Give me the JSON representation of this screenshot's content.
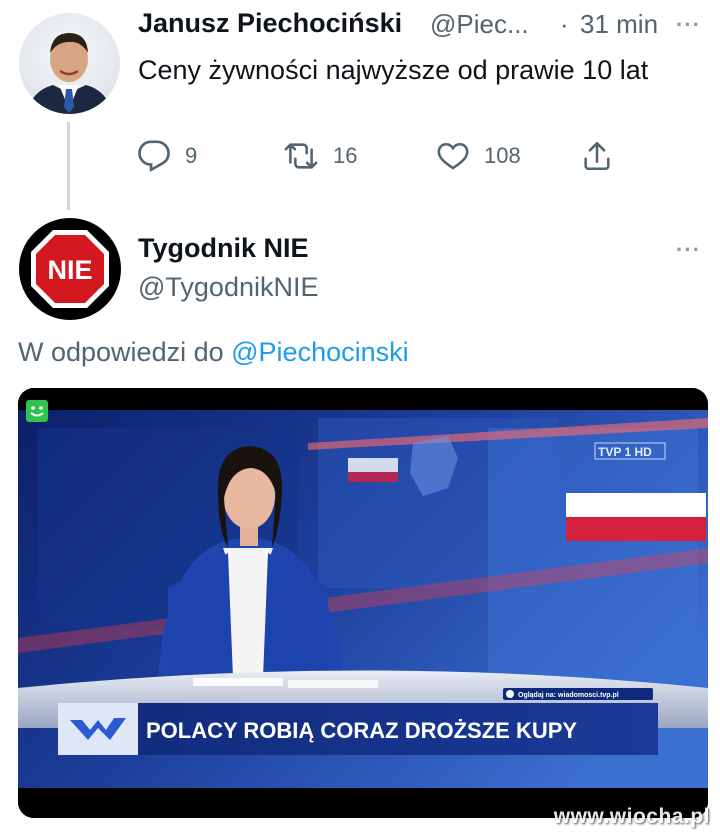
{
  "tweet1": {
    "name": "Janusz Piechociński",
    "handle": "@Piec...",
    "separator": "·",
    "time": "31 min",
    "more": "···",
    "text": "Ceny żywności najwyższe od prawie 10 lat",
    "replies": "9",
    "retweets": "16",
    "likes": "108"
  },
  "tweet2": {
    "name": "Tygodnik NIE",
    "handle": "@TygodnikNIE",
    "more": "···",
    "avatar_text": "NIE",
    "reply_prefix": "W odpowiedzi do",
    "reply_mention": "@Piechocinski"
  },
  "media": {
    "channel_logo": "TVP 1 HD",
    "watch_note": "Oglądaj na: wiadomosci.tvp.pl",
    "headline": "POLACY ROBIĄ CORAZ DROŻSZE KUPY"
  },
  "watermark": "www.wiocha.pl",
  "colors": {
    "accent": "#1d9bf0",
    "secondary_text": "#536471",
    "nie_red": "#d3181f",
    "studio_blue": "#1d3f9c"
  },
  "icons": [
    "reply-icon",
    "retweet-icon",
    "like-icon",
    "share-icon",
    "more-icon",
    "smiley-icon"
  ]
}
